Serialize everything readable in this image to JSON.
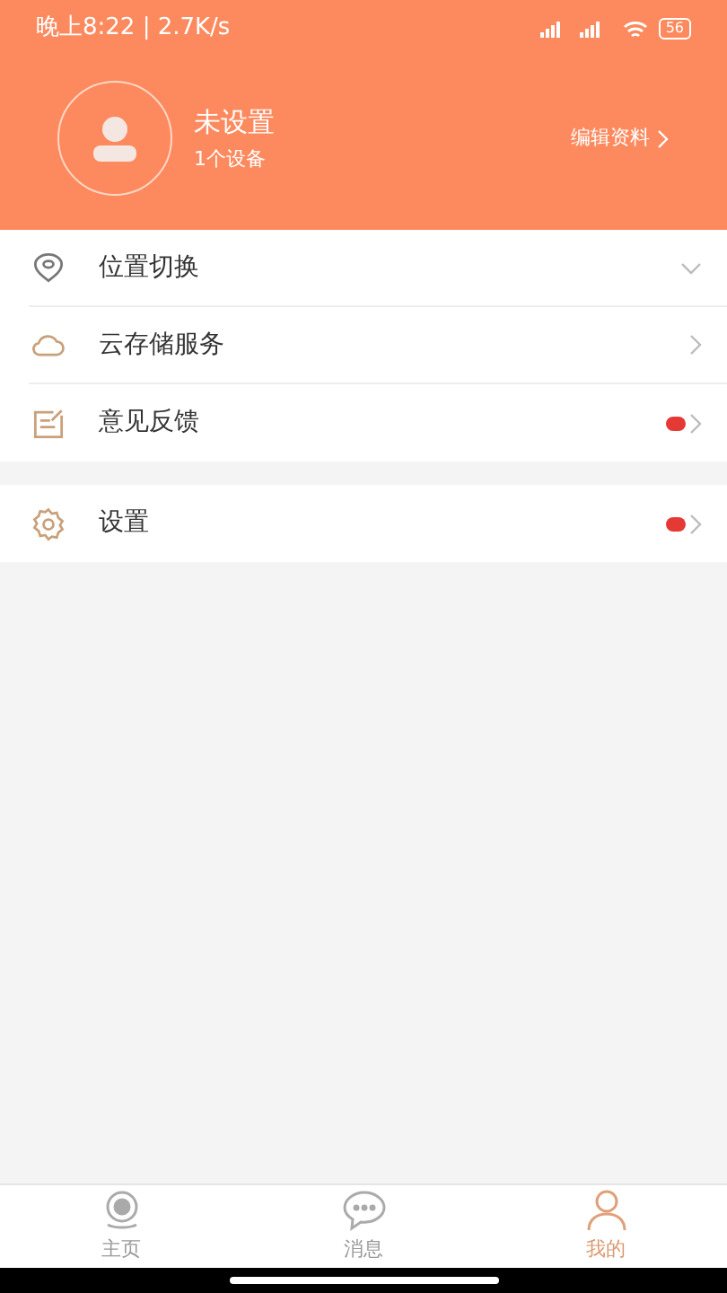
{
  "status_bar": {
    "time": "晚上8:22 | 2.7K/s",
    "battery": "56"
  },
  "profile": {
    "name": "未设置",
    "devices": "1个设备",
    "edit": "编辑资料"
  },
  "menu_groups": [
    {
      "items": [
        {
          "label": "位置切换",
          "kind": "expand",
          "badge": false
        },
        {
          "label": "云存储服务",
          "kind": "link",
          "badge": false
        },
        {
          "label": "意见反馈",
          "kind": "link",
          "badge": true
        }
      ]
    },
    {
      "items": [
        {
          "label": "设置",
          "kind": "link",
          "badge": true
        }
      ]
    }
  ],
  "tabs": [
    {
      "label": "主页",
      "selected": false
    },
    {
      "label": "消息",
      "selected": false
    },
    {
      "label": "我的",
      "selected": true
    }
  ]
}
